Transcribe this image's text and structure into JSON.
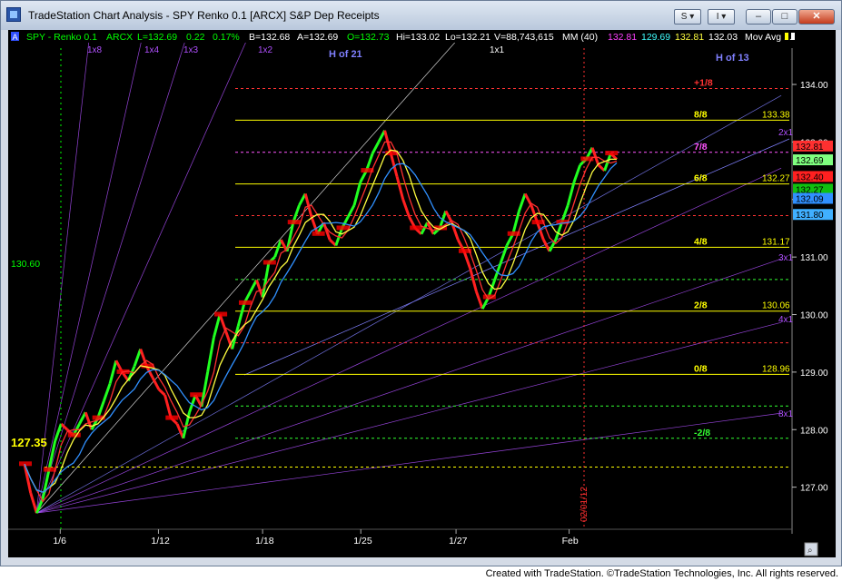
{
  "window": {
    "title": "TradeStation Chart Analysis - SPY Renko 0.1 [ARCX] S&P Dep Receipts",
    "menu_s_label": "S",
    "menu_i_label": "I",
    "minimize": "–",
    "maximize": "□",
    "close": "✕"
  },
  "infobar": {
    "a_label": "A",
    "symbol": "SPY - Renko 0.1",
    "exchange": "ARCX",
    "last": "L=132.69",
    "change": "0.22",
    "pct": "0.17%",
    "bid": "B=132.68",
    "ask": "A=132.69",
    "open": "O=132.73",
    "hi": "Hi=133.02",
    "lo": "Lo=132.21",
    "volume": "V=88,743,615",
    "mm": "MM (40)",
    "mm1": "132.81",
    "mm2": "129.69",
    "mm3": "132.81",
    "mm4": "132.03",
    "mov_avg": "Mov Avg ..."
  },
  "annotations": {
    "h21": "H of 21",
    "h13": "H of 13",
    "g1x8": "1x8",
    "g1x4": "1x4",
    "g1x3": "1x3",
    "g1x2": "1x2",
    "g1x1": "1x1",
    "g2x1": "2x1",
    "g3x1": "3x1",
    "g4x1": "4x1",
    "g8x1": "8x1",
    "price_left_1": "130.60",
    "price_left_2": "127.35",
    "date_marker": "02/01/12"
  },
  "murrey": [
    {
      "label": "+1/8",
      "price": 133.93,
      "value": "",
      "color": "#ff3333",
      "style": "dash"
    },
    {
      "label": "8/8",
      "price": 133.38,
      "value": "133.38",
      "color": "#ffff00",
      "style": "solid"
    },
    {
      "label": "7/8",
      "price": 132.82,
      "value": "",
      "color": "#ff55ff",
      "style": "dash"
    },
    {
      "label": "6/8",
      "price": 132.27,
      "value": "132.27",
      "color": "#ffff00",
      "style": "solid"
    },
    {
      "label": "",
      "price": 131.72,
      "value": "",
      "color": "#ff3333",
      "style": "dash"
    },
    {
      "label": "4/8",
      "price": 131.17,
      "value": "131.17",
      "color": "#ffff00",
      "style": "solid"
    },
    {
      "label": "",
      "price": 130.61,
      "value": "",
      "color": "#33ff33",
      "style": "dash"
    },
    {
      "label": "2/8",
      "price": 130.06,
      "value": "130.06",
      "color": "#ffff00",
      "style": "solid"
    },
    {
      "label": "",
      "price": 129.51,
      "value": "",
      "color": "#ff3333",
      "style": "dash"
    },
    {
      "label": "0/8",
      "price": 128.96,
      "value": "128.96",
      "color": "#ffff00",
      "style": "solid"
    },
    {
      "label": "",
      "price": 128.41,
      "value": "",
      "color": "#33ff33",
      "style": "dash"
    },
    {
      "label": "-2/8",
      "price": 127.85,
      "value": "",
      "color": "#33ff33",
      "style": "dash"
    },
    {
      "label": "",
      "price": 127.35,
      "value": "",
      "color": "#ffff00",
      "style": "dash"
    }
  ],
  "chart_data": {
    "type": "line",
    "ylim": [
      126.3,
      134.6
    ],
    "y_ticks": [
      "134.00",
      "133.00",
      "132.00",
      "131.00",
      "130.00",
      "129.00",
      "128.00",
      "127.00"
    ],
    "y_tick_values": [
      134,
      133,
      132,
      131,
      130,
      129,
      128,
      127
    ],
    "x_labels": [
      "1/6",
      "1/12",
      "1/18",
      "1/25",
      "1/27",
      "Feb"
    ],
    "x_label_index": [
      12,
      45,
      80,
      113,
      145,
      183
    ],
    "bar_count": 200,
    "series": [
      {
        "name": "SPY",
        "values": [
          127.4,
          126.9,
          126.55,
          126.8,
          127.3,
          127.8,
          128.1,
          128.0,
          127.9,
          128.1,
          128.3,
          128.0,
          128.2,
          128.5,
          128.8,
          129.2,
          129.0,
          128.85,
          129.1,
          129.4,
          129.1,
          128.9,
          128.7,
          128.6,
          128.2,
          128.1,
          127.85,
          128.3,
          128.6,
          128.4,
          129.0,
          129.6,
          130.0,
          129.7,
          129.4,
          129.8,
          130.2,
          130.4,
          130.6,
          130.3,
          130.9,
          131.0,
          131.3,
          131.1,
          131.6,
          131.9,
          132.1,
          131.7,
          131.4,
          131.6,
          131.3,
          131.2,
          131.5,
          131.7,
          131.9,
          132.3,
          132.5,
          132.8,
          133.0,
          133.2,
          132.8,
          132.4,
          132.0,
          131.7,
          131.5,
          131.4,
          131.6,
          131.4,
          131.5,
          131.8,
          131.6,
          131.3,
          131.1,
          130.8,
          130.4,
          130.1,
          130.3,
          130.6,
          130.9,
          131.2,
          131.4,
          131.8,
          132.1,
          131.9,
          131.6,
          131.3,
          131.1,
          131.3,
          131.6,
          131.9,
          132.3,
          132.6,
          132.7,
          132.9,
          132.6,
          132.5,
          132.8,
          132.7
        ]
      }
    ]
  },
  "right_tags": [
    {
      "text": "132.69",
      "bg": "#7fff7f",
      "fg": "#000000",
      "price": 132.69
    },
    {
      "text": "132.81",
      "bg": "#ff3030",
      "fg": "#000000",
      "price": 132.93
    },
    {
      "text": "132.40",
      "bg": "#ff2020",
      "fg": "#000000",
      "price": 132.4
    },
    {
      "text": "132.27",
      "bg": "#10c010",
      "fg": "#000000",
      "price": 132.18
    },
    {
      "text": "132.09",
      "bg": "#3090ff",
      "fg": "#000000",
      "price": 132.02
    },
    {
      "text": "131.80",
      "bg": "#40b0ff",
      "fg": "#000000",
      "price": 131.74
    }
  ],
  "status": {
    "text": "Created with TradeStation. ©TradeStation Technologies, Inc. All rights reserved."
  }
}
